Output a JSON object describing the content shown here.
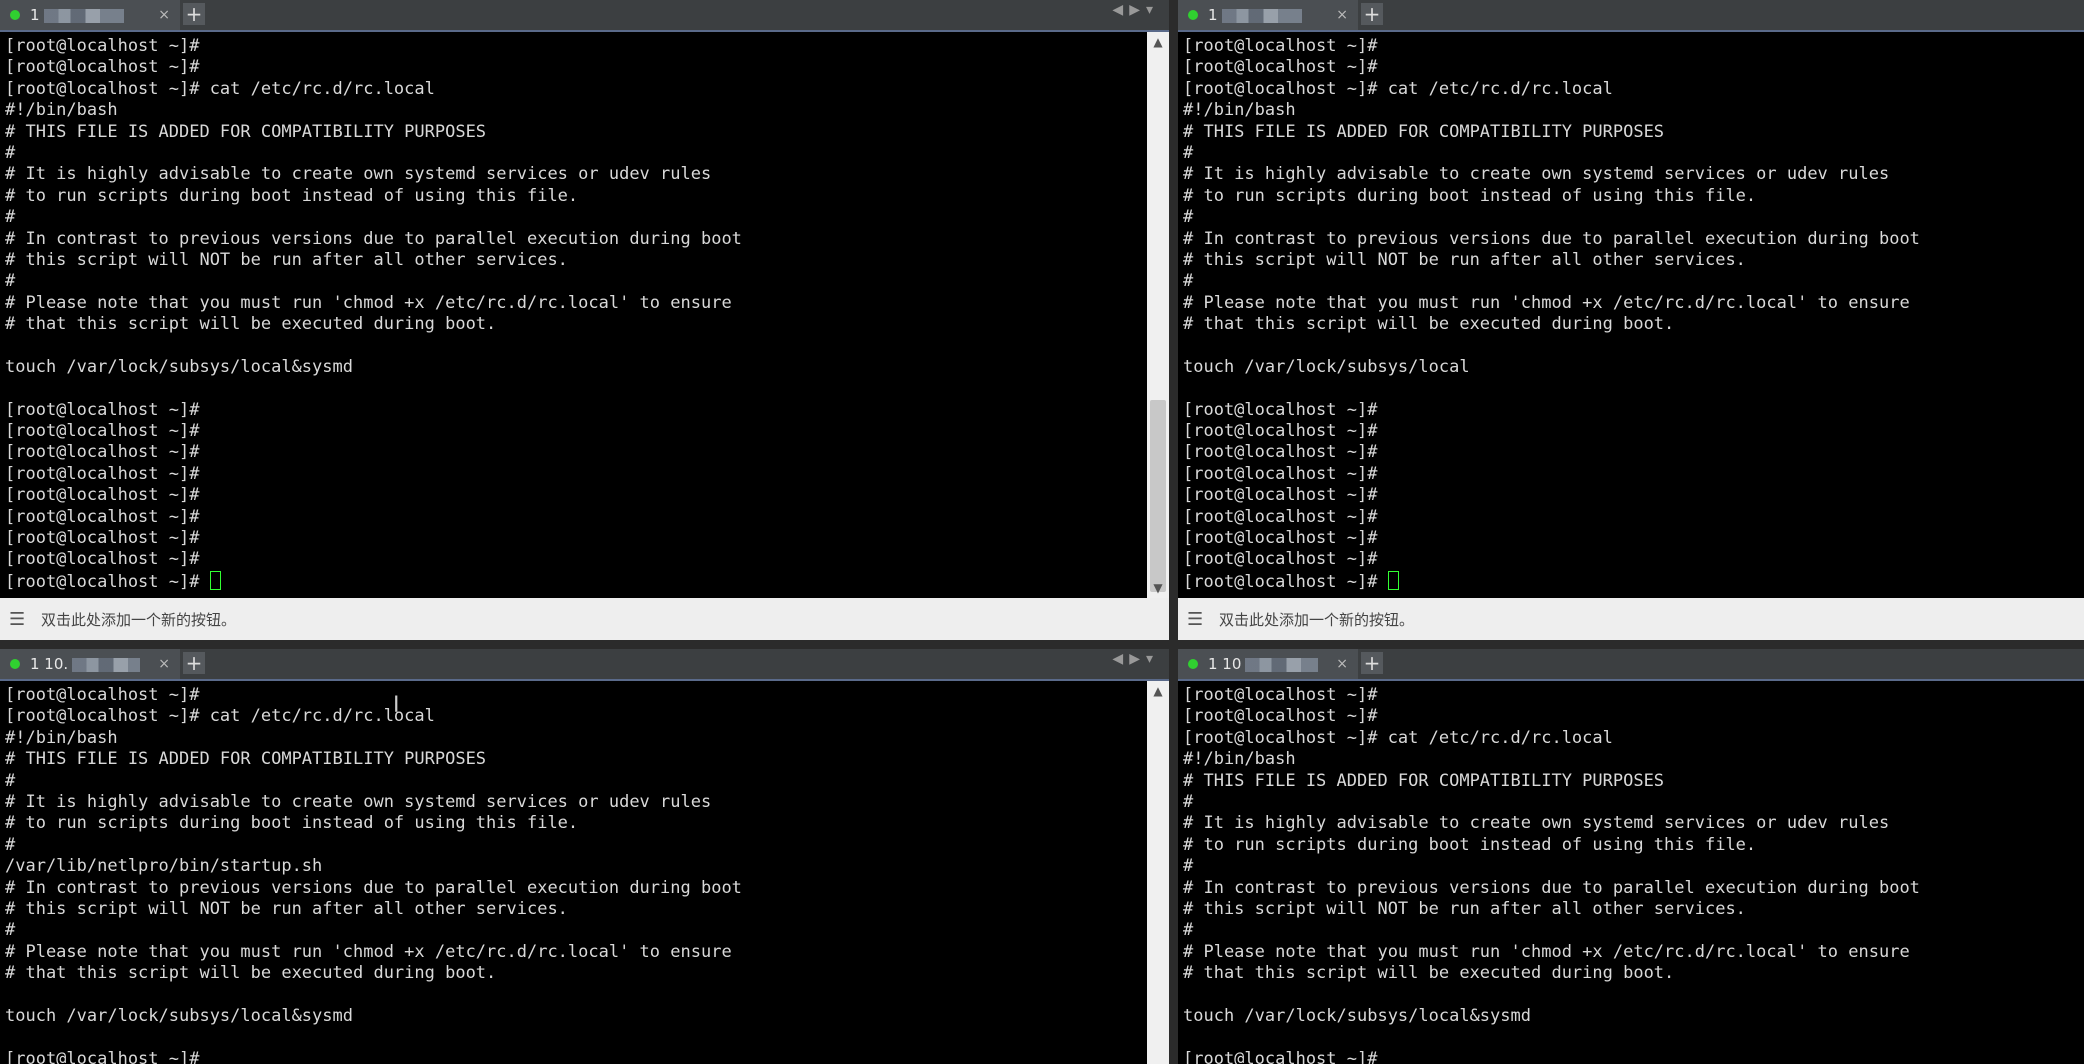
{
  "tab_close_glyph": "×",
  "add_tab_glyph": "+",
  "nav_left_glyph": "◀",
  "nav_right_glyph": "▶",
  "nav_menu_glyph": "▾",
  "cmdbar_hint": "双击此处添加一个新的按钮。",
  "colors": {
    "terminal_bg": "#000000",
    "terminal_fg": "#d9d9d9",
    "cursor": "#32ff32",
    "status_dot": "#30d030"
  },
  "panes": [
    {
      "tab_title": "1",
      "lines": [
        "[root@localhost ~]#",
        "[root@localhost ~]#",
        "[root@localhost ~]# cat /etc/rc.d/rc.local",
        "#!/bin/bash",
        "# THIS FILE IS ADDED FOR COMPATIBILITY PURPOSES",
        "#",
        "# It is highly advisable to create own systemd services or udev rules",
        "# to run scripts during boot instead of using this file.",
        "#",
        "# In contrast to previous versions due to parallel execution during boot",
        "# this script will NOT be run after all other services.",
        "#",
        "# Please note that you must run 'chmod +x /etc/rc.d/rc.local' to ensure",
        "# that this script will be executed during boot.",
        "",
        "touch /var/lock/subsys/local&sysmd",
        "",
        "[root@localhost ~]#",
        "[root@localhost ~]#",
        "[root@localhost ~]#",
        "[root@localhost ~]#",
        "[root@localhost ~]#",
        "[root@localhost ~]#",
        "[root@localhost ~]#",
        "[root@localhost ~]#",
        "[root@localhost ~]# "
      ]
    },
    {
      "tab_title": "1",
      "lines": [
        "[root@localhost ~]#",
        "[root@localhost ~]#",
        "[root@localhost ~]# cat /etc/rc.d/rc.local",
        "#!/bin/bash",
        "# THIS FILE IS ADDED FOR COMPATIBILITY PURPOSES",
        "#",
        "# It is highly advisable to create own systemd services or udev rules",
        "# to run scripts during boot instead of using this file.",
        "#",
        "# In contrast to previous versions due to parallel execution during boot",
        "# this script will NOT be run after all other services.",
        "#",
        "# Please note that you must run 'chmod +x /etc/rc.d/rc.local' to ensure",
        "# that this script will be executed during boot.",
        "",
        "touch /var/lock/subsys/local",
        "",
        "[root@localhost ~]#",
        "[root@localhost ~]#",
        "[root@localhost ~]#",
        "[root@localhost ~]#",
        "[root@localhost ~]#",
        "[root@localhost ~]#",
        "[root@localhost ~]#",
        "[root@localhost ~]#",
        "[root@localhost ~]# "
      ]
    },
    {
      "tab_title": "1 10.",
      "lines": [
        "[root@localhost ~]#",
        "[root@localhost ~]# cat /etc/rc.d/rc.local",
        "#!/bin/bash",
        "# THIS FILE IS ADDED FOR COMPATIBILITY PURPOSES",
        "#",
        "# It is highly advisable to create own systemd services or udev rules",
        "# to run scripts during boot instead of using this file.",
        "#",
        "/var/lib/netlpro/bin/startup.sh",
        "# In contrast to previous versions due to parallel execution during boot",
        "# this script will NOT be run after all other services.",
        "#",
        "# Please note that you must run 'chmod +x /etc/rc.d/rc.local' to ensure",
        "# that this script will be executed during boot.",
        "",
        "touch /var/lock/subsys/local&sysmd",
        "",
        "[root@localhost ~]#"
      ]
    },
    {
      "tab_title": "1 10",
      "lines": [
        "[root@localhost ~]#",
        "[root@localhost ~]#",
        "[root@localhost ~]# cat /etc/rc.d/rc.local",
        "#!/bin/bash",
        "# THIS FILE IS ADDED FOR COMPATIBILITY PURPOSES",
        "#",
        "# It is highly advisable to create own systemd services or udev rules",
        "# to run scripts during boot instead of using this file.",
        "#",
        "# In contrast to previous versions due to parallel execution during boot",
        "# this script will NOT be run after all other services.",
        "#",
        "# Please note that you must run 'chmod +x /etc/rc.d/rc.local' to ensure",
        "# that this script will be executed during boot.",
        "",
        "touch /var/lock/subsys/local&sysmd",
        "",
        "[root@localhost ~]#"
      ]
    }
  ]
}
